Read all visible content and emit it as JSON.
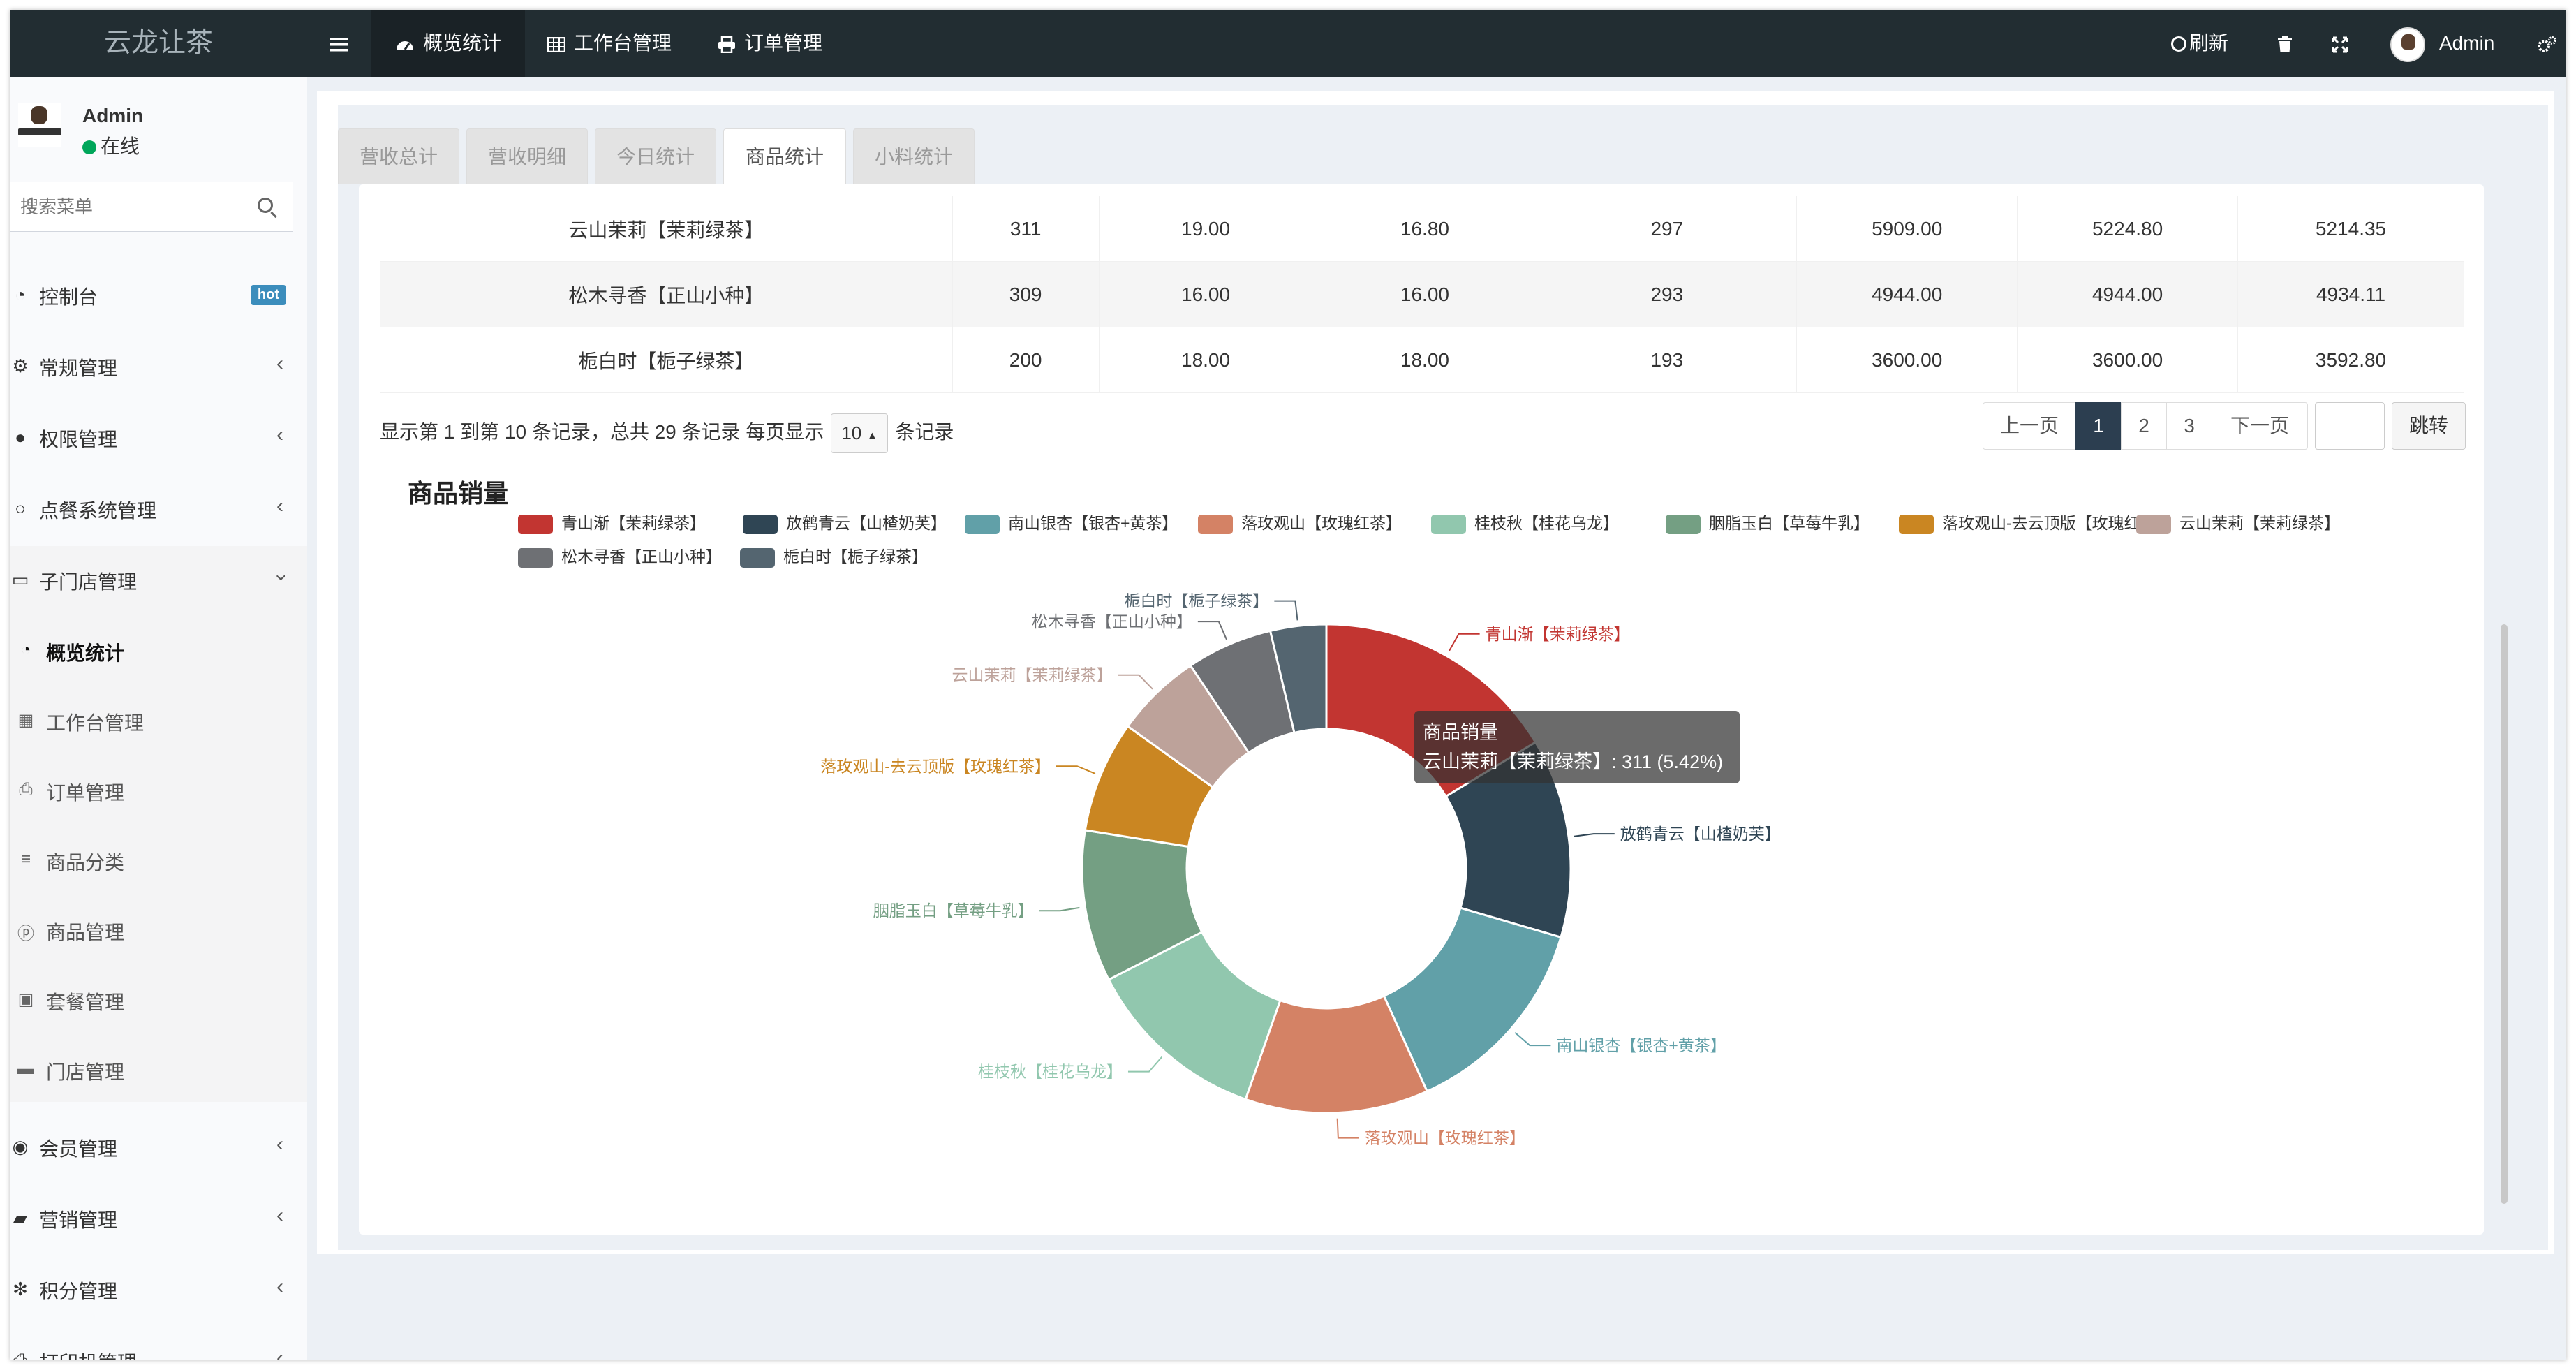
{
  "header": {
    "logo": "云龙让茶",
    "menu_icon": "bars-icon",
    "nav": [
      {
        "label": "概览统计",
        "icon": "dashboard-icon"
      },
      {
        "label": "工作台管理",
        "icon": "table-icon"
      },
      {
        "label": "订单管理",
        "icon": "print-icon"
      }
    ],
    "refresh_label": "刷新",
    "user_name": "Admin"
  },
  "sidebar": {
    "user": {
      "name": "Admin",
      "status": "在线"
    },
    "search": {
      "placeholder": "搜索菜单"
    },
    "items": [
      {
        "label": "控制台",
        "icon": "dashboard-icon",
        "badge": "hot"
      },
      {
        "label": "常规管理",
        "icon": "cogs-icon"
      },
      {
        "label": "权限管理",
        "icon": "group-icon"
      },
      {
        "label": "点餐系统管理",
        "icon": "circle-o-icon"
      },
      {
        "label": "子门店管理",
        "icon": "desktop-icon"
      }
    ],
    "subitems": [
      {
        "label": "概览统计",
        "icon": "dashboard-icon"
      },
      {
        "label": "工作台管理",
        "icon": "table-icon"
      },
      {
        "label": "订单管理",
        "icon": "print-icon"
      },
      {
        "label": "商品分类",
        "icon": "list-icon"
      },
      {
        "label": "商品管理",
        "icon": "product-hunt-icon"
      },
      {
        "label": "套餐管理",
        "icon": "briefcase-icon"
      },
      {
        "label": "门店管理",
        "icon": "store-icon"
      }
    ],
    "items_after": [
      {
        "label": "会员管理",
        "icon": "user-circle-icon"
      },
      {
        "label": "营销管理",
        "icon": "shopping-bag-icon"
      },
      {
        "label": "积分管理",
        "icon": "pinwheel-icon"
      },
      {
        "label": "打印机管理",
        "icon": "printer-icon"
      }
    ]
  },
  "tabs": [
    "营收总计",
    "营收明细",
    "今日统计",
    "商品统计",
    "小料统计"
  ],
  "table": {
    "rows": [
      [
        "云山茉莉【茉莉绿茶】",
        "311",
        "19.00",
        "16.80",
        "297",
        "5909.00",
        "5224.80",
        "5214.35"
      ],
      [
        "松木寻香【正山小种】",
        "309",
        "16.00",
        "16.00",
        "293",
        "4944.00",
        "4944.00",
        "4934.11"
      ],
      [
        "栀白时【栀子绿茶】",
        "200",
        "18.00",
        "18.00",
        "193",
        "3600.00",
        "3600.00",
        "3592.80"
      ]
    ]
  },
  "pagination": {
    "info_prefix": "显示第 1 到第 10 条记录，总共 29 条记录 每页显示",
    "page_size": "10",
    "info_suffix": "条记录",
    "prev": "上一页",
    "pages": [
      "1",
      "2",
      "3"
    ],
    "next": "下一页",
    "jump": "跳转"
  },
  "tooltip": {
    "title": "商品销量",
    "text": "云山茉莉【茉莉绿茶】: 311 (5.42%)"
  },
  "chart_data": {
    "type": "pie",
    "title": "商品销量",
    "donut": true,
    "legend_position": "top",
    "slices": [
      {
        "name": "青山渐【茉莉绿茶】",
        "value": 15.5,
        "color": "#c23531"
      },
      {
        "name": "放鹤青云【山楂奶芙】",
        "value": 12.5,
        "color": "#2f4554"
      },
      {
        "name": "南山银杏【银杏+黄茶】",
        "value": 13.0,
        "color": "#61a0a8"
      },
      {
        "name": "落玫观山【玫瑰红茶】",
        "value": 11.5,
        "color": "#d48265"
      },
      {
        "name": "桂枝秋【桂花乌龙】",
        "value": 11.5,
        "color": "#91c7ae"
      },
      {
        "name": "胭脂玉白【草莓牛乳】",
        "value": 9.5,
        "color": "#749f83"
      },
      {
        "name": "落玫观山-去云顶版【玫瑰红茶】",
        "value": 7.0,
        "color": "#ca8622"
      },
      {
        "name": "云山茉莉【茉莉绿茶】",
        "value": 5.42,
        "color": "#bda29a"
      },
      {
        "name": "松木寻香【正山小种】",
        "value": 5.4,
        "color": "#6e7074"
      },
      {
        "name": "栀白时【栀子绿茶】",
        "value": 3.5,
        "color": "#546570"
      }
    ]
  }
}
